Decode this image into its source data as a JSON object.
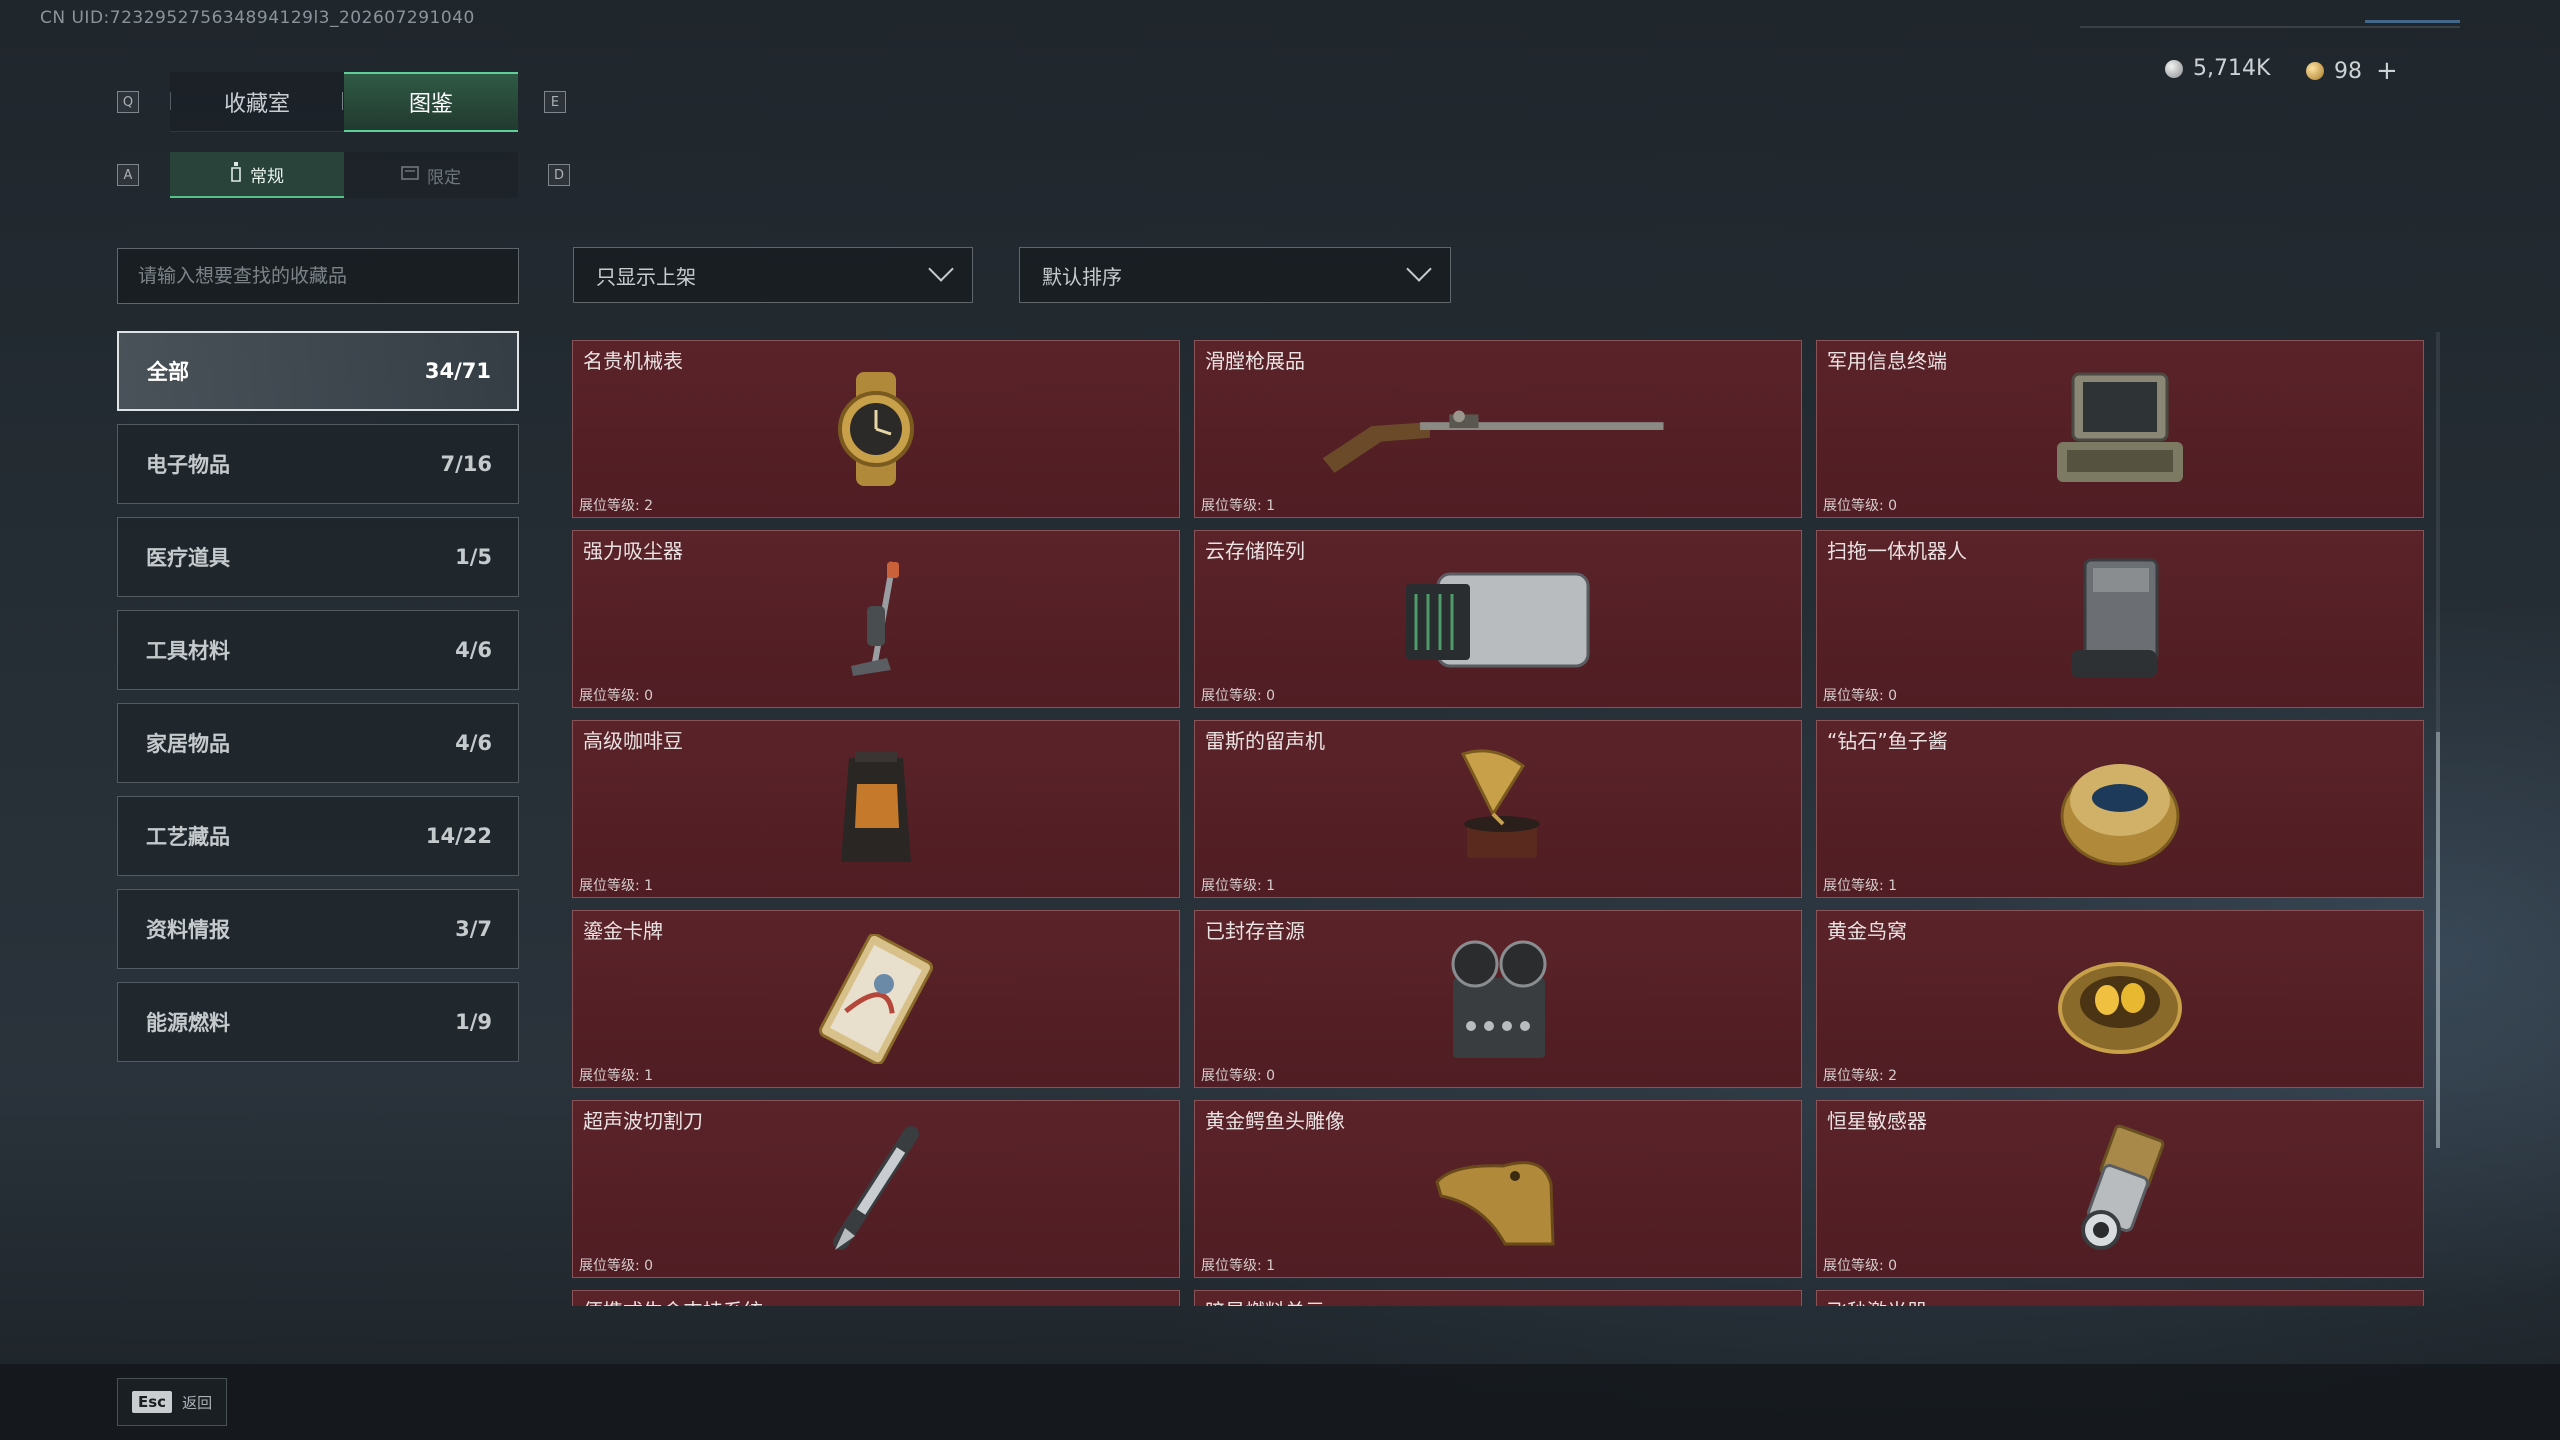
{
  "uid": "CN UID:723295275634894129l3_202607291040",
  "header": {
    "key_left": "Q",
    "key_right": "E",
    "tabs": [
      {
        "label": "收藏室",
        "active": false
      },
      {
        "label": "图鉴",
        "active": true
      }
    ],
    "subkey_left": "A",
    "subkey_right": "D",
    "subtabs": [
      {
        "label": "常规",
        "icon": "bottle-icon",
        "active": true
      },
      {
        "label": "限定",
        "icon": "card-icon",
        "active": false
      }
    ]
  },
  "currency": {
    "silver": "5,714K",
    "gold": "98",
    "add": "+"
  },
  "search": {
    "placeholder": "请输入想要查找的收藏品",
    "value": ""
  },
  "filters": {
    "shelf": "只显示上架",
    "sort": "默认排序"
  },
  "categories": [
    {
      "label": "全部",
      "count": "34/71",
      "active": true
    },
    {
      "label": "电子物品",
      "count": "7/16"
    },
    {
      "label": "医疗道具",
      "count": "1/5"
    },
    {
      "label": "工具材料",
      "count": "4/6"
    },
    {
      "label": "家居物品",
      "count": "4/6"
    },
    {
      "label": "工艺藏品",
      "count": "14/22"
    },
    {
      "label": "资料情报",
      "count": "3/7"
    },
    {
      "label": "能源燃料",
      "count": "1/9"
    }
  ],
  "items": [
    {
      "name": "名贵机械表",
      "level": "展位等级: 2",
      "icon": "watch-icon"
    },
    {
      "name": "滑膛枪展品",
      "level": "展位等级: 1",
      "icon": "musket-icon"
    },
    {
      "name": "军用信息终端",
      "level": "展位等级: 0",
      "icon": "terminal-icon"
    },
    {
      "name": "强力吸尘器",
      "level": "展位等级: 0",
      "icon": "vacuum-icon"
    },
    {
      "name": "云存储阵列",
      "level": "展位等级: 0",
      "icon": "storage-array-icon"
    },
    {
      "name": "扫拖一体机器人",
      "level": "展位等级: 0",
      "icon": "robot-dock-icon"
    },
    {
      "name": "高级咖啡豆",
      "level": "展位等级: 1",
      "icon": "coffee-bag-icon"
    },
    {
      "name": "雷斯的留声机",
      "level": "展位等级: 1",
      "icon": "gramophone-icon"
    },
    {
      "name": "“钻石”鱼子酱",
      "level": "展位等级: 1",
      "icon": "caviar-tin-icon"
    },
    {
      "name": "鎏金卡牌",
      "level": "展位等级: 1",
      "icon": "gilded-card-icon"
    },
    {
      "name": "已封存音源",
      "level": "展位等级: 0",
      "icon": "reel-recorder-icon"
    },
    {
      "name": "黄金鸟窝",
      "level": "展位等级: 2",
      "icon": "golden-nest-icon"
    },
    {
      "name": "超声波切割刀",
      "level": "展位等级: 0",
      "icon": "cutter-icon"
    },
    {
      "name": "黄金鳄鱼头雕像",
      "level": "展位等级: 1",
      "icon": "croc-head-icon"
    },
    {
      "name": "恒星敏感器",
      "level": "展位等级: 0",
      "icon": "star-sensor-icon"
    },
    {
      "name": "便携式生命支持系统",
      "level": "",
      "icon": ""
    },
    {
      "name": "暗星燃料单元",
      "level": "",
      "icon": ""
    },
    {
      "name": "飞秒激光器",
      "level": "",
      "icon": ""
    }
  ],
  "footer": {
    "esc_key": "Esc",
    "esc_label": "返回"
  }
}
